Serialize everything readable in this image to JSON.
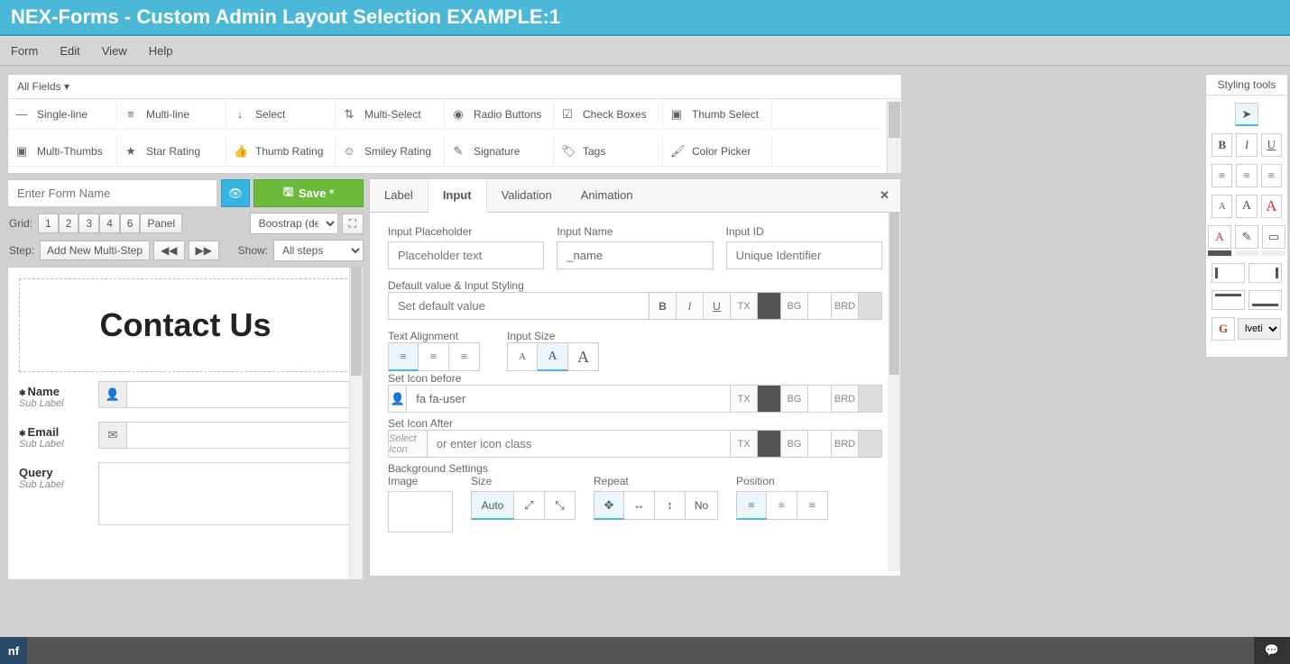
{
  "title": "NEX-Forms - Custom Admin Layout Selection EXAMPLE:1",
  "menu": [
    "Form",
    "Edit",
    "View",
    "Help"
  ],
  "fields_dropdown": "All Fields",
  "fields": [
    {
      "icon": "—",
      "label": "Single-line"
    },
    {
      "icon": "≡",
      "label": "Multi-line"
    },
    {
      "icon": "↓",
      "label": "Select"
    },
    {
      "icon": "⇅",
      "label": "Multi-Select"
    },
    {
      "icon": "◉",
      "label": "Radio Buttons"
    },
    {
      "icon": "☑",
      "label": "Check Boxes"
    },
    {
      "icon": "▣",
      "label": "Thumb Select"
    },
    {
      "icon": "",
      "label": ""
    },
    {
      "icon": "▣",
      "label": "Multi-Thumbs"
    },
    {
      "icon": "★",
      "label": "Star Rating"
    },
    {
      "icon": "👍",
      "label": "Thumb Rating"
    },
    {
      "icon": "☺",
      "label": "Smiley Rating"
    },
    {
      "icon": "✎",
      "label": "Signature"
    },
    {
      "icon": "🏷",
      "label": "Tags"
    },
    {
      "icon": "🖌",
      "label": "Color Picker"
    },
    {
      "icon": "",
      "label": ""
    }
  ],
  "form_name_placeholder": "Enter Form Name",
  "save_label": "Save *",
  "grid_label": "Grid:",
  "grid_buttons": [
    "1",
    "2",
    "3",
    "4",
    "6",
    "Panel"
  ],
  "theme_select": "Boostrap (defa",
  "step_label": "Step:",
  "add_step": "Add New Multi-Step",
  "show_label": "Show:",
  "show_select": "All steps",
  "canvas": {
    "heading": "Contact Us",
    "fields": [
      {
        "label": "Name",
        "required": true,
        "sub": "Sub Label",
        "icon": "user",
        "type": "text"
      },
      {
        "label": "Email",
        "required": true,
        "sub": "Sub Label",
        "icon": "mail",
        "type": "text"
      },
      {
        "label": "Query",
        "required": false,
        "sub": "Sub Label",
        "icon": "",
        "type": "textarea"
      }
    ]
  },
  "tabs": [
    "Label",
    "Input",
    "Validation",
    "Animation"
  ],
  "active_tab": 1,
  "props": {
    "placeholder_label": "Input Placeholder",
    "placeholder_ph": "Placeholder text",
    "name_label": "Input Name",
    "name_value": "_name",
    "id_label": "Input ID",
    "id_ph": "Unique Identifier",
    "default_label": "Default value & Input Styling",
    "default_ph": "Set default value",
    "align_label": "Text Alignment",
    "size_label": "Input Size",
    "icon_before_label": "Set Icon before",
    "icon_before_value": "fa fa-user",
    "icon_after_label": "Set Icon After",
    "icon_after_ph": "Select Icon",
    "icon_after_ph2": "or enter icon class",
    "bg_label": "Background Settings",
    "bg_image": "Image",
    "bg_size": "Size",
    "bg_auto": "Auto",
    "bg_repeat": "Repeat",
    "bg_no": "No",
    "bg_position": "Position",
    "tx": "TX",
    "bg": "BG",
    "brd": "BRD"
  },
  "styling_title": "Styling tools",
  "font_value": "lvetica",
  "nf": "nf"
}
